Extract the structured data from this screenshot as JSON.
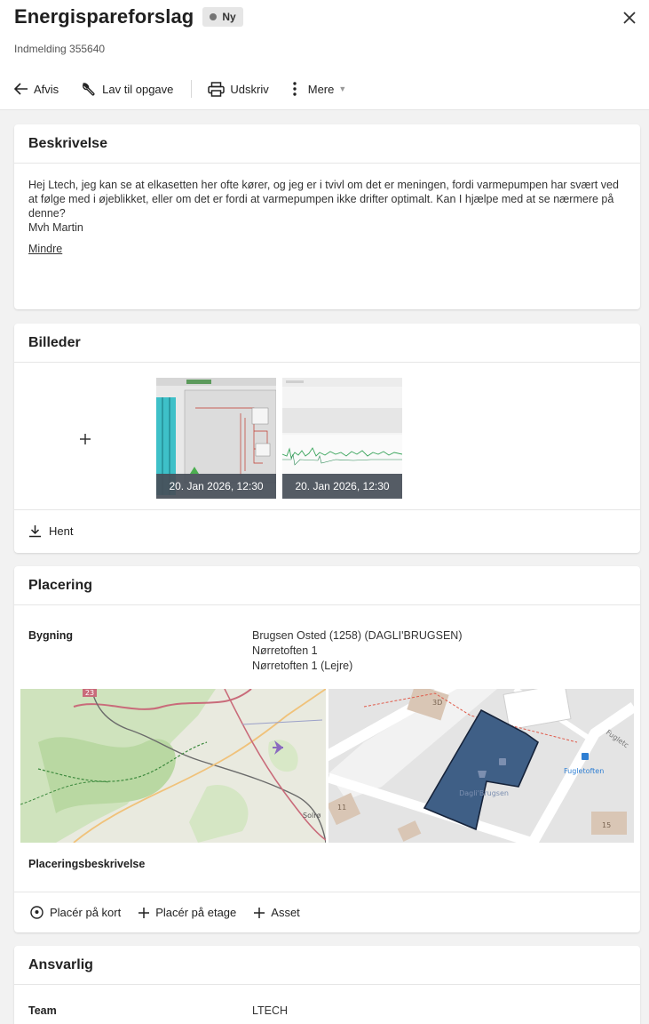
{
  "header": {
    "title": "Energispareforslag",
    "badge": "Ny",
    "subtitle": "Indmelding 355640"
  },
  "toolbar": {
    "reject_label": "Afvis",
    "task_label": "Lav til opgave",
    "print_label": "Udskriv",
    "more_label": "Mere"
  },
  "description": {
    "title": "Beskrivelse",
    "text": "Hej Ltech, jeg kan se at elkasetten her ofte kører, og jeg er i tvivl om det er meningen, fordi varmepumpen har svært ved at følge med i øjeblikket, eller om det er fordi at varmepumpen ikke drifter optimalt. Kan I hjælpe med at se nærmere på denne?",
    "signature": "Mvh Martin",
    "less_label": "Mindre"
  },
  "images": {
    "title": "Billeder",
    "items": [
      {
        "timestamp": "20. Jan 2026, 12:30"
      },
      {
        "timestamp": "20. Jan 2026, 12:30"
      }
    ],
    "download_label": "Hent"
  },
  "placement": {
    "title": "Placering",
    "building_label": "Bygning",
    "building_name": "Brugsen Osted (1258) (DAGLI'BRUGSEN)",
    "address1": "Nørretoften 1",
    "address2": "Nørretoften 1 (Lejre)",
    "overview_map": {
      "road_number": "23",
      "town": "Solrø"
    },
    "detail_map": {
      "house_3d": "3D",
      "street_top_right": "Fugletc",
      "bus_stop": "Fugletoften",
      "store_label": "Dagli'Brugsen",
      "house_11": "11",
      "house_15": "15"
    },
    "placement_desc_label": "Placeringsbeskrivelse",
    "place_on_map_label": "Placér på kort",
    "place_on_floor_label": "Placér på etage",
    "asset_label": "Asset"
  },
  "responsible": {
    "title": "Ansvarlig",
    "team_label": "Team",
    "team_value": "LTECH"
  },
  "colors": {
    "building_fill": "#3f5f86",
    "map_green": "#cfe3bd",
    "badge_bg": "#e6e6e6"
  }
}
